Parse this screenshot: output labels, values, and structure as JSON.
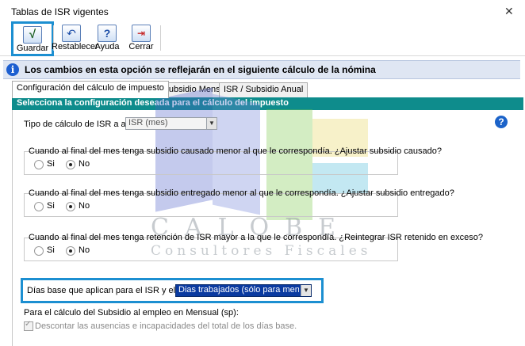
{
  "window": {
    "title": "Tablas de ISR vigentes"
  },
  "toolbar": {
    "save_label": "Guardar",
    "reset_label": "Restablecer",
    "help_label": "Ayuda",
    "close_label": "Cerrar"
  },
  "info_banner": {
    "text": "Los cambios en esta opción se reflejarán en el siguiente cálculo de la nómina"
  },
  "tabs": [
    {
      "label": "Configuración del cálculo de impuesto",
      "active": true
    },
    {
      "label": "ISR / Subsidio Mensual",
      "active": false
    },
    {
      "label": "ISR / Subsidio Anual",
      "active": false
    }
  ],
  "section": {
    "header": "Selecciona la configuración deseada para el cálculo del impuesto"
  },
  "isr_type": {
    "label": "Tipo de cálculo de ISR a aplicar:",
    "value": "ISR (mes)"
  },
  "groups": [
    {
      "title": "Cuando al final del mes tenga subsidio causado menor al que le correspondía. ¿Ajustar subsidio causado?",
      "yes": "Si",
      "no": "No",
      "selected": "No"
    },
    {
      "title": "Cuando al final del mes tenga subsidio entregado menor al que le correspondía. ¿Ajustar subsidio entregado?",
      "yes": "Si",
      "no": "No",
      "selected": "No"
    },
    {
      "title": "Cuando al final del mes tenga retención de ISR mayor a la que le correspondía. ¿Reintegrar ISR retenido en exceso?",
      "yes": "Si",
      "no": "No",
      "selected": "No"
    }
  ],
  "dias_base": {
    "label": "Días base que aplican para el  ISR y el Subsidio:",
    "value": "Dias trabajados (sólo para mensual sp)"
  },
  "subsidio": {
    "label": "Para el cálculo del Subsidio al empleo en Mensual (sp):",
    "discount_label": "Descontar las ausencias e incapacidades del total de los días base.",
    "discount_checked": true
  },
  "watermark": {
    "brand": "CALOBE",
    "tagline": "Consultores Fiscales"
  }
}
